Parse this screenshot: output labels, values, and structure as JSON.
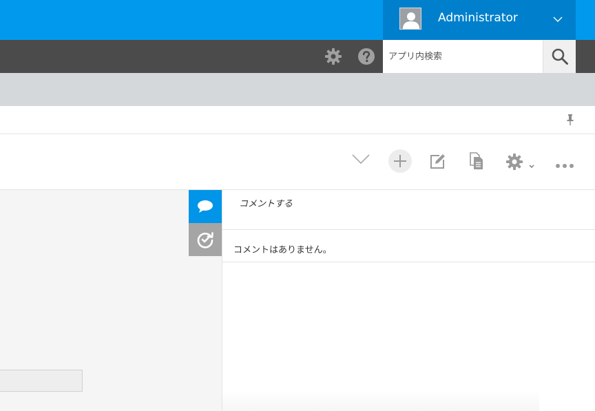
{
  "header": {
    "user_name": "Administrator"
  },
  "subheader": {
    "search_placeholder": "アプリ内検索"
  },
  "comments": {
    "compose_label": "コメントする",
    "empty_message": "コメントはありません。"
  },
  "colors": {
    "brand_blue": "#0099ee",
    "user_menu_bg": "#0080cc",
    "dark_bar": "#4b4b4b",
    "gray_bar": "#d4d8da",
    "active_tab": "#0095e8",
    "inactive_tab": "#a5a5a5"
  },
  "icons": [
    "user-avatar-icon",
    "chevron-down-icon",
    "gear-icon",
    "help-icon",
    "search-icon",
    "pin-icon",
    "plus-icon",
    "edit-icon",
    "copy-document-icon",
    "more-icon",
    "comment-icon",
    "history-icon"
  ]
}
